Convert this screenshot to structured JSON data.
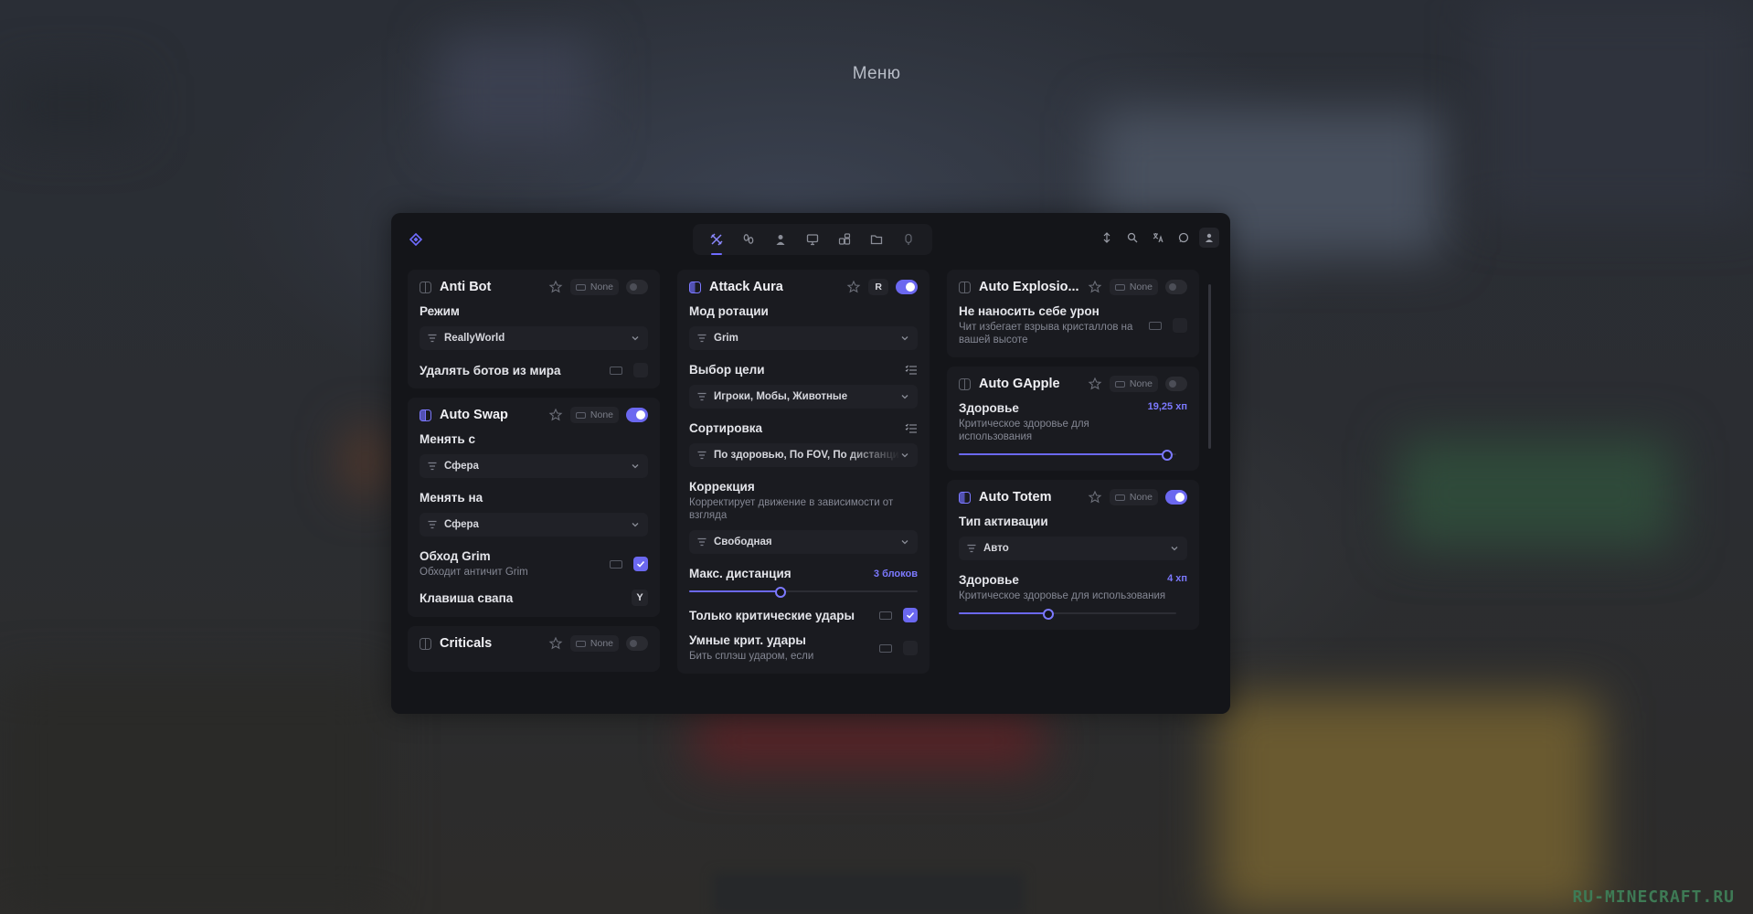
{
  "header": {
    "menu_title": "Меню"
  },
  "watermark": "RU-MINECRAFT.RU",
  "tabs": [
    {
      "icon": "combat-icon",
      "active": true
    },
    {
      "icon": "movement-icon",
      "active": false
    },
    {
      "icon": "player-icon",
      "active": false
    },
    {
      "icon": "render-icon",
      "active": false
    },
    {
      "icon": "misc-icon",
      "active": false
    },
    {
      "icon": "folder-icon",
      "active": false
    },
    {
      "icon": "script-icon",
      "active": false
    }
  ],
  "toolbar_icons": [
    "sort-icon",
    "search-icon",
    "translate-icon",
    "chat-icon",
    "profile-icon"
  ],
  "accent_color": "#6b68f0",
  "column1": {
    "antibot": {
      "name": "Anti Bot",
      "bind": "None",
      "enabled": false,
      "mode_label": "Режим",
      "mode_value": "ReallyWorld",
      "remove_label": "Удалять ботов из мира"
    },
    "autoswap": {
      "name": "Auto Swap",
      "bind": "None",
      "enabled": true,
      "from_label": "Менять с",
      "from_value": "Сфера",
      "to_label": "Менять на",
      "to_value": "Сфера",
      "grim_label": "Обход Grim",
      "grim_desc": "Обходит античит Grim",
      "key_label": "Клавиша свапа",
      "key_value": "Y"
    },
    "criticals": {
      "name": "Criticals",
      "bind": "None"
    }
  },
  "column2": {
    "aura": {
      "name": "Attack Aura",
      "bind": "R",
      "enabled": true,
      "rotation_label": "Мод ротации",
      "rotation_value": "Grim",
      "target_label": "Выбор цели",
      "target_value": "Игроки, Мобы, Животные",
      "sort_label": "Сортировка",
      "sort_value": "По здоровью, По FOV, По дистанции",
      "correction_label": "Коррекция",
      "correction_desc": "Корректирует движение в зависимости от взгляда",
      "correction_value": "Свободная",
      "distance_label": "Макс. дистанция",
      "distance_value": "3 блоков",
      "distance_fraction": 0.4,
      "crit_label": "Только критические удары",
      "smart_crit_label": "Умные крит. удары",
      "smart_crit_desc": "Бить сплэш ударом, если"
    }
  },
  "column3": {
    "autoexplosion": {
      "name": "Auto Explosio...",
      "bind": "None",
      "enabled": false,
      "no_damage_label": "Не наносить себе урон",
      "no_damage_desc": "Чит избегает взрыва кристаллов на вашей высоте"
    },
    "autogapple": {
      "name": "Auto GApple",
      "bind": "None",
      "enabled": false,
      "health_label": "Здоровье",
      "health_value": "19,25 хп",
      "health_desc": "Критическое здоровье для использования",
      "health_fraction": 0.96
    },
    "autototem": {
      "name": "Auto Totem",
      "bind": "None",
      "enabled": true,
      "activation_label": "Тип активации",
      "activation_value": "Авто",
      "health_label": "Здоровье",
      "health_value": "4 хп",
      "health_desc": "Критическое здоровье для использования",
      "health_fraction": 0.41
    }
  }
}
